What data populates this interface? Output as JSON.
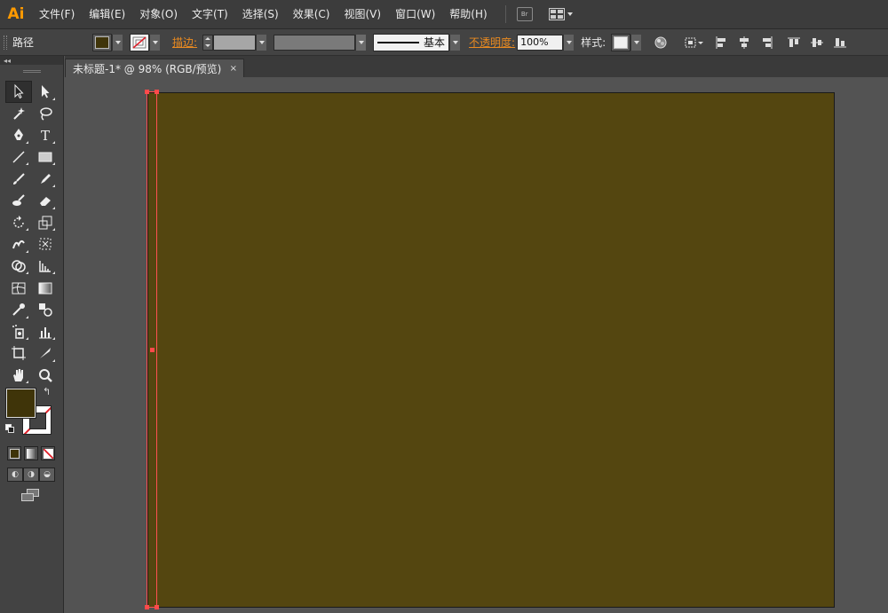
{
  "app": {
    "logo": "Ai",
    "menus": [
      "文件(F)",
      "编辑(E)",
      "对象(O)",
      "文字(T)",
      "选择(S)",
      "效果(C)",
      "视图(V)",
      "窗口(W)",
      "帮助(H)"
    ],
    "bridge_label": "Br"
  },
  "controlbar": {
    "selection_type": "路径",
    "stroke_label": "描边:",
    "stroke_profile": "基本",
    "opacity_label": "不透明度:",
    "opacity_value": "100%",
    "style_label": "样式:"
  },
  "document_tab": {
    "title": "未标题-1* @ 98% (RGB/预览)",
    "close": "×"
  },
  "toolbox": {
    "collapse": "◂◂",
    "swap_symbol": "↰"
  },
  "colors": {
    "fill": "#3f3409",
    "artboard": "#544610",
    "selection": "#ff4a4a",
    "accent": "#ff9a00",
    "stroke_none": "#e0202a"
  }
}
